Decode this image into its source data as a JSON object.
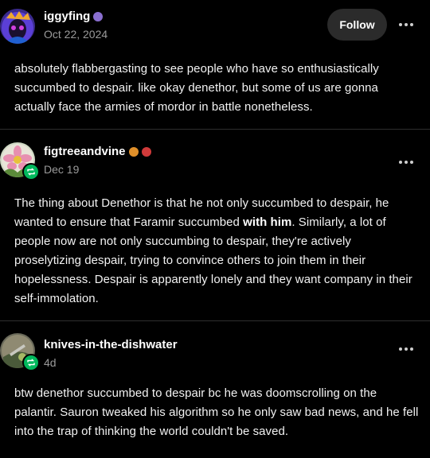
{
  "posts": [
    {
      "username": "iggyfing",
      "date": "Oct 22, 2024",
      "follow_label": "Follow",
      "text": "absolutely flabbergasting to see people who have so enthusiastically succumbed to despair. like okay denethor, but some of us are gonna actually face the armies of mordor in battle nonetheless."
    },
    {
      "username": "figtreeandvine",
      "date": "Dec 19",
      "text_before": "The thing about Denethor is that he not only succumbed to despair, he wanted to ensure that Faramir succumbed ",
      "text_bold": "with him",
      "text_after": ".  Similarly, a lot of people now are not only succumbing to despair, they're actively proselytizing despair, trying to convince others to join them in their hopelessness.  Despair is apparently lonely and they want company in their self-immolation."
    },
    {
      "username": "knives-in-the-dishwater",
      "date": "4d",
      "text": "btw denethor succumbed to despair bc he was doomscrolling on the palantir. Sauron tweaked his algorithm so he only saw bad news, and he fell into the trap of thinking the world couldn't be saved."
    }
  ],
  "colors": {
    "background": "#000000",
    "reblog_badge": "#00b85c",
    "follow_button": "#2b2b2b",
    "date_text": "#9a9a9a"
  },
  "icons": {
    "more": "ellipsis-icon",
    "reblog": "reblog-icon"
  }
}
